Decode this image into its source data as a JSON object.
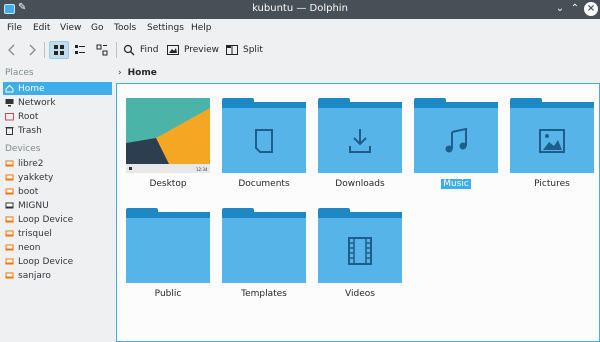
{
  "window": {
    "title": "kubuntu — Dolphin"
  },
  "menubar": {
    "items": [
      "File",
      "Edit",
      "View",
      "Go",
      "Tools",
      "Settings",
      "Help"
    ]
  },
  "toolbar": {
    "find_label": "Find",
    "preview_label": "Preview",
    "split_label": "Split"
  },
  "sidebar": {
    "places_title": "Places",
    "places": [
      "Home",
      "Network",
      "Root",
      "Trash"
    ],
    "devices_title": "Devices",
    "devices": [
      "libre2",
      "yakkety",
      "boot",
      "MIGNU",
      "Loop Device",
      "trisquel",
      "neon",
      "Loop Device",
      "sanjaro"
    ]
  },
  "breadcrumb": {
    "current": "Home"
  },
  "items": [
    "Desktop",
    "Documents",
    "Downloads",
    "Music",
    "Pictures",
    "Public",
    "Templates",
    "Videos"
  ],
  "desktop_thumb_clock": "12:34",
  "colors": {
    "accent": "#3daee9",
    "folder_dark": "#1d88c3",
    "folder_light": "#56b4e9",
    "titlebar": "#475057"
  }
}
